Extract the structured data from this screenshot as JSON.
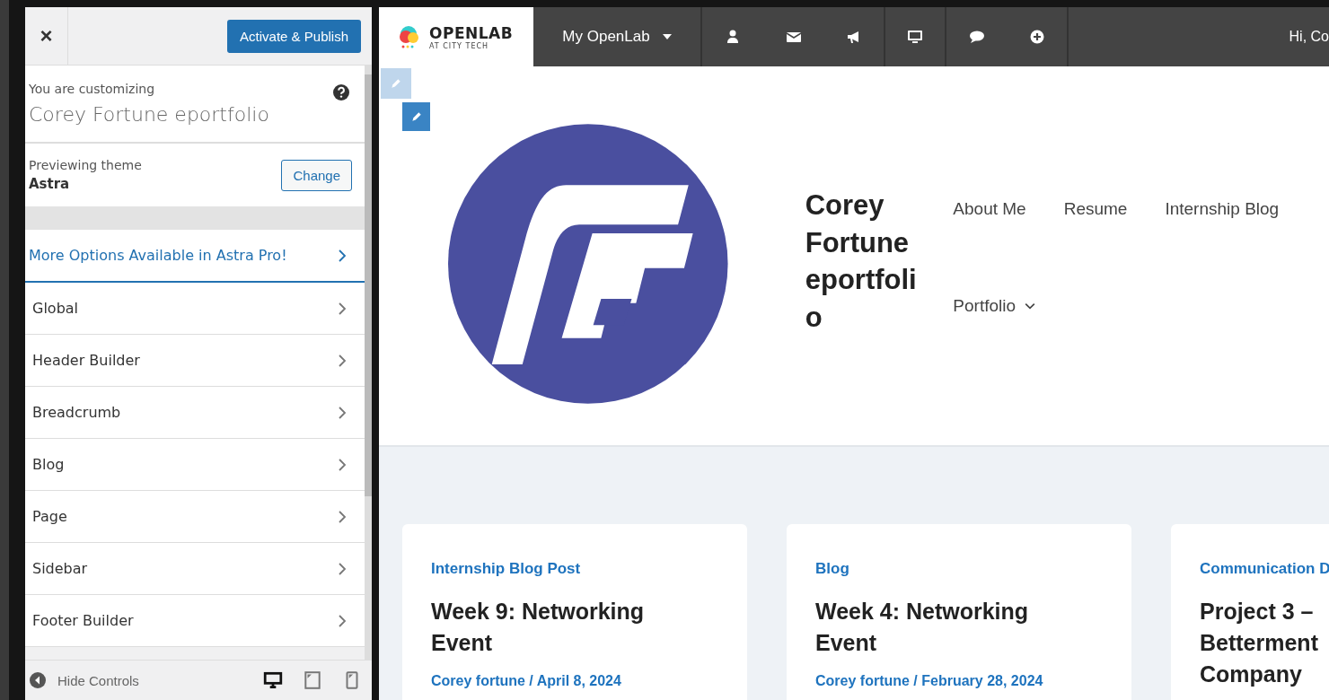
{
  "customizer": {
    "close_label": "×",
    "publish_button": "Activate & Publish",
    "customizing_label": "You are customizing",
    "site_name": "Corey Fortune eportfolio",
    "previewing_label": "Previewing theme",
    "theme_name": "Astra",
    "change_button": "Change",
    "sections": [
      {
        "label": "More Options Available in Astra Pro!",
        "kind": "promo"
      },
      {
        "label": "Global",
        "kind": "section"
      },
      {
        "label": "Header Builder",
        "kind": "section"
      },
      {
        "label": "Breadcrumb",
        "kind": "section"
      },
      {
        "label": "Blog",
        "kind": "section"
      },
      {
        "label": "Page",
        "kind": "section"
      },
      {
        "label": "Sidebar",
        "kind": "section"
      },
      {
        "label": "Footer Builder",
        "kind": "section"
      }
    ],
    "hide_controls": "Hide Controls",
    "devices": [
      {
        "selected": true
      },
      {
        "selected": false
      },
      {
        "selected": false
      }
    ]
  },
  "admin_bar": {
    "logo_title": "OPENLAB",
    "logo_subtitle": "AT CITY TECH",
    "my_openlab": "My OpenLab",
    "greeting": "Hi, Co"
  },
  "site": {
    "title": "Corey Fortune eportfolio",
    "nav": [
      {
        "label": "About Me",
        "dropdown": false
      },
      {
        "label": "Resume",
        "dropdown": false
      },
      {
        "label": "Internship Blog",
        "dropdown": false
      },
      {
        "label": "Portfolio",
        "dropdown": true
      }
    ]
  },
  "posts": [
    {
      "category": "Internship Blog Post",
      "title": "Week 9: Networking Event",
      "meta": "Corey fortune / April 8, 2024"
    },
    {
      "category": "Blog",
      "title": "Week 4: Networking Event",
      "meta": "Corey fortune / February 28, 2024"
    },
    {
      "category": "Communication D",
      "title": "Project 3 – Betterment Company"
    }
  ]
}
